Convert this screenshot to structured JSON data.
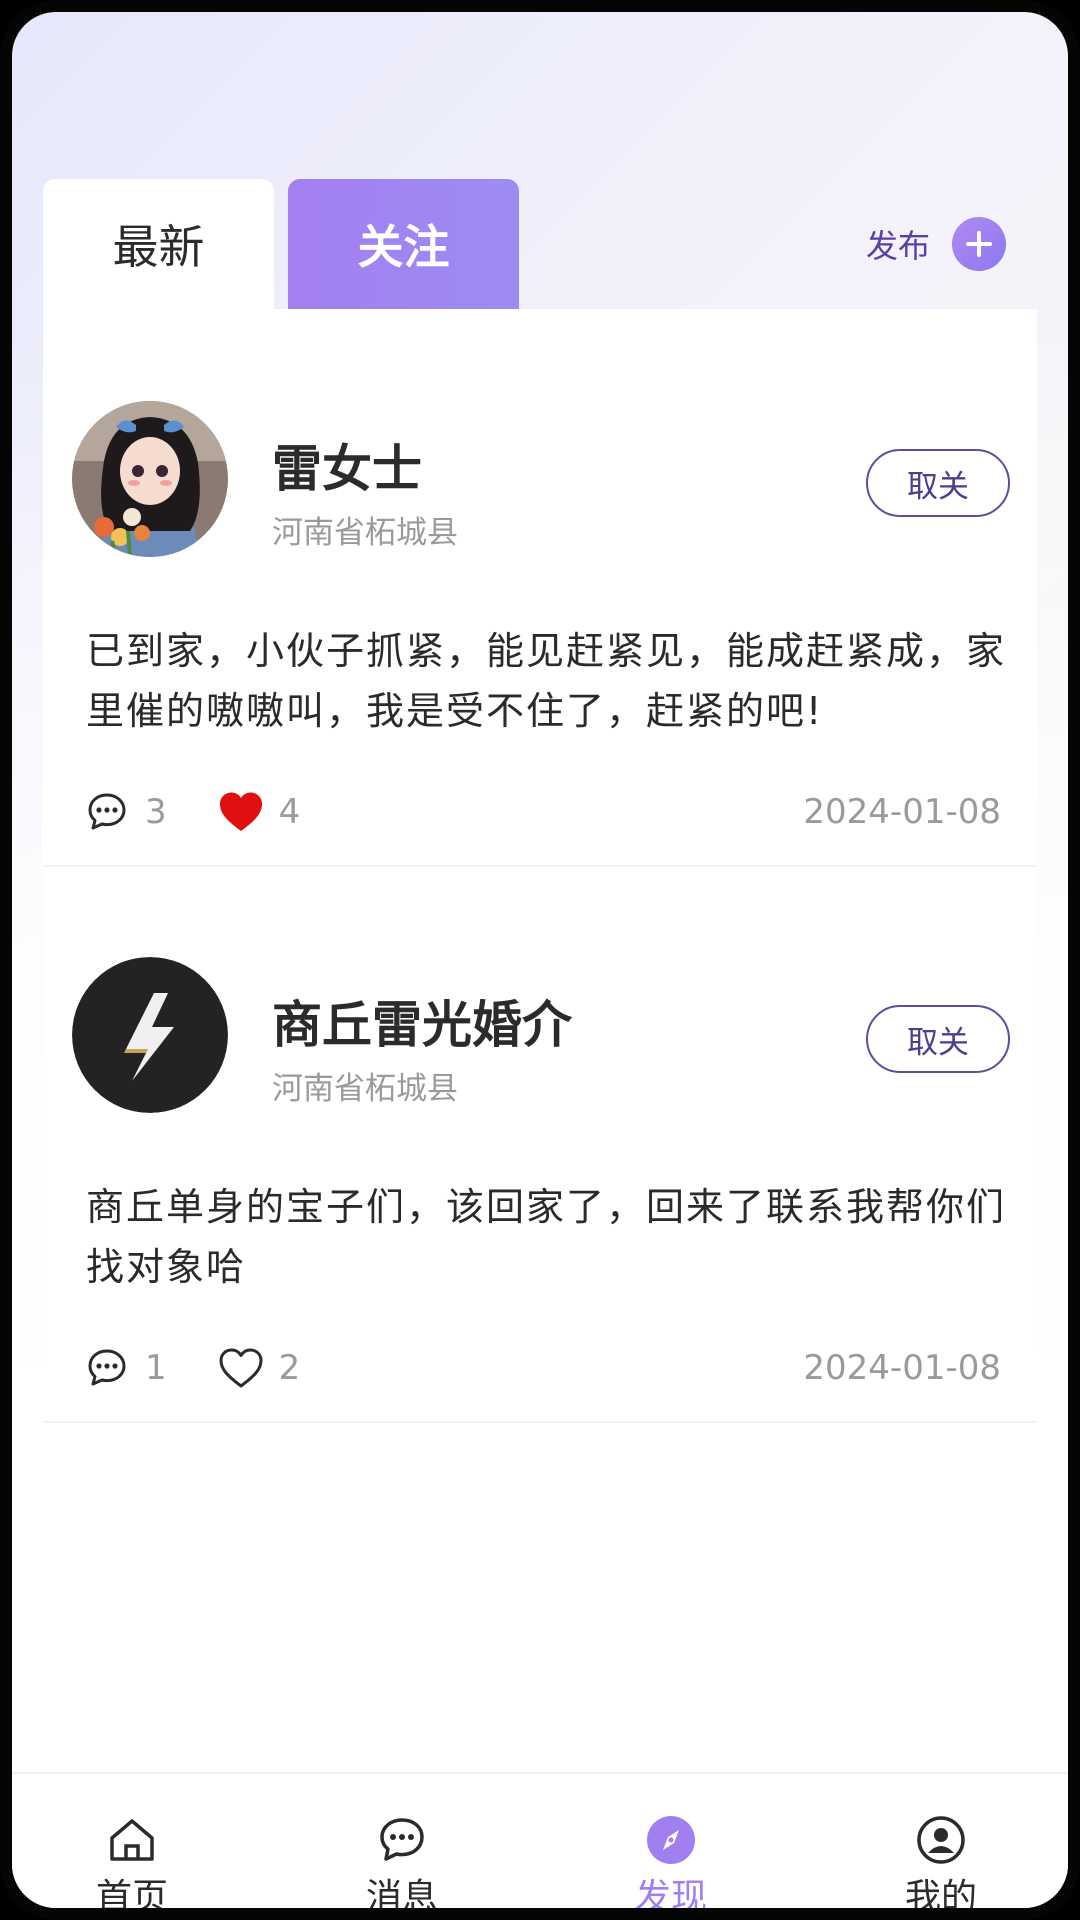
{
  "tabs": {
    "latest": "最新",
    "follow": "关注"
  },
  "publish": {
    "label": "发布",
    "icon": "plus-circle-icon"
  },
  "posts": [
    {
      "name": "雷女士",
      "location": "河南省柘城县",
      "action": "取关",
      "content": "已到家，小伙子抓紧，能见赶紧见，能成赶紧成，家里催的嗷嗷叫，我是受不住了，赶紧的吧!",
      "comments": "3",
      "likes": "4",
      "liked": true,
      "date": "2024-01-08"
    },
    {
      "name": "商丘雷光婚介",
      "location": "河南省柘城县",
      "action": "取关",
      "content": "商丘单身的宝子们，该回家了，回来了联系我帮你们找对象哈",
      "comments": "1",
      "likes": "2",
      "liked": false,
      "date": "2024-01-08"
    }
  ],
  "nav": {
    "home": "首页",
    "messages": "消息",
    "discover": "发现",
    "mine": "我的"
  },
  "colors": {
    "accent": "#a27ff0",
    "like": "#e01010",
    "unfollow_border": "#5a4e9e"
  }
}
